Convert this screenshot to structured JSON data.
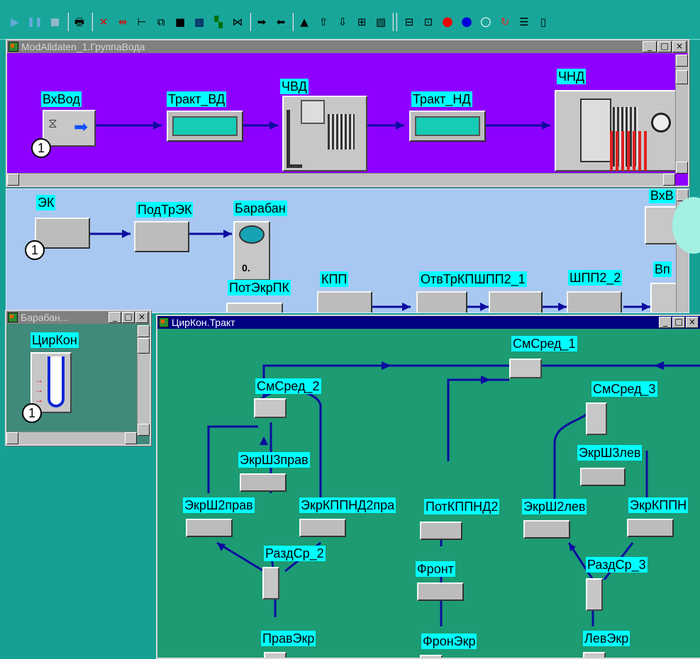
{
  "toolbar": {
    "icons": [
      "play-icon",
      "pause-icon",
      "stop-icon",
      "printer-icon",
      "cross-icon",
      "cross-arrows-icon",
      "hierarchy-icon",
      "window-stack-icon",
      "square-icon",
      "grid-icon",
      "palette-icon",
      "bowtie-icon",
      "arrow-right-icon",
      "arrow-left-icon",
      "triangle-icon",
      "import-icon",
      "export-icon",
      "windows-icon",
      "chart-icon",
      "panel-icon",
      "train-icon",
      "red-dot-icon",
      "blue-dot-icon",
      "white-dot-icon",
      "cycle-icon",
      "list-icon",
      "clipboard-icon"
    ]
  },
  "windows": {
    "water_group": {
      "title": "ModAlldaten_1.ГруппаВода",
      "blocks": [
        {
          "label": "ВхВод",
          "badge": "1"
        },
        {
          "label": "Тракт_ВД"
        },
        {
          "label": "ЧВД"
        },
        {
          "label": "Тракт_НД"
        },
        {
          "label": "ЧНД"
        }
      ]
    },
    "middle_group": {
      "blocks": [
        {
          "label": "ЭК",
          "badge": "1"
        },
        {
          "label": "ПодТрЭК"
        },
        {
          "label": "Барабан",
          "value": "0."
        },
        {
          "label": "ВхВ"
        },
        {
          "label": "КПП"
        },
        {
          "label": "ОтвТрКПШПП2_1"
        },
        {
          "label": "ШПП2_2"
        },
        {
          "label": "Вп"
        },
        {
          "label": "ПотЭкрПК"
        }
      ]
    },
    "drum": {
      "title": "Барабан...",
      "blocks": [
        {
          "label": "ЦирКон",
          "badge": "1"
        }
      ]
    },
    "circ": {
      "title": "ЦирКон.Тракт",
      "blocks": [
        {
          "label": "СмСред_1"
        },
        {
          "label": "СмСред_2"
        },
        {
          "label": "СмСред_3"
        },
        {
          "label": "ЭкрШ3прав"
        },
        {
          "label": "ЭкрШ3лев"
        },
        {
          "label": "ЭкрШ2прав"
        },
        {
          "label": "ЭкрКППНД2пра"
        },
        {
          "label": "ПотКППНД2"
        },
        {
          "label": "ЭкрШ2лев"
        },
        {
          "label": "ЭкрКППН"
        },
        {
          "label": "РаздСр_2"
        },
        {
          "label": "Фронт"
        },
        {
          "label": "РаздСр_3"
        },
        {
          "label": "ПравЭкр"
        },
        {
          "label": "ФронЭкр"
        },
        {
          "label": "ЛевЭкр"
        }
      ]
    }
  },
  "window_controls": {
    "minimize": "_",
    "restore": "□",
    "close": "×"
  },
  "colors": {
    "desktop": "#16a093",
    "water_bg": "#8d00ff",
    "middle_bg": "#a9c8f1",
    "drum_bg": "#3f8a7a",
    "circ_bg": "#1d9b73",
    "label_bg": "#00ffff",
    "flow": "#0c0ca0"
  }
}
